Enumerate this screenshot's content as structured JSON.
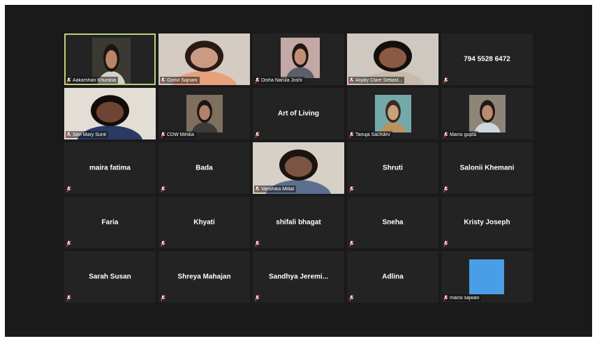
{
  "participants": [
    {
      "name": "Aakarshan Khurana",
      "display": "",
      "type": "video",
      "bg": "#3a3a33",
      "skin": "#b88666",
      "hair": "#1b1511",
      "shirt": "#d5d1c8"
    },
    {
      "name": "Gonvi Sajnani",
      "display": "",
      "type": "video",
      "bg": "#d4cbc3",
      "skin": "#c99b82",
      "hair": "#2b1a14",
      "shirt": "#e8a07c"
    },
    {
      "name": "Disha Narula Joshi",
      "display": "",
      "type": "video",
      "bg": "#c4a8a6",
      "skin": "#c18f74",
      "hair": "#221712",
      "shirt": "#5a5f6b"
    },
    {
      "name": "Anjaly Clare Sebast...",
      "display": "",
      "type": "video",
      "bg": "#cfc8c0",
      "skin": "#8b5a44",
      "hair": "#140f0d",
      "shirt": "#c9b9a9"
    },
    {
      "name": "",
      "display": "794 5528 6472",
      "type": "text"
    },
    {
      "name": "Silvi Mary Sunil",
      "display": "",
      "type": "video",
      "bg": "#e2ddd5",
      "skin": "#6e4535",
      "hair": "#120d0b",
      "shirt": "#2a3a63"
    },
    {
      "name": "CDW Mihika",
      "display": "",
      "type": "video",
      "bg": "#7e6f5f",
      "skin": "#b0826a",
      "hair": "#1e1612",
      "shirt": "#3d3a38"
    },
    {
      "name": "",
      "display": "Art of Living",
      "type": "text"
    },
    {
      "name": "Tanuja Sachdev",
      "display": "",
      "type": "video",
      "bg": "#74a9a9",
      "skin": "#c8a27e",
      "hair": "#3e2a1e",
      "shirt": "#b9925f"
    },
    {
      "name": "Mansi gupta",
      "display": "",
      "type": "video",
      "bg": "#8e8579",
      "skin": "#ba8b70",
      "hair": "#231813",
      "shirt": "#cfd6de"
    },
    {
      "name": "",
      "display": "maira fatima",
      "type": "text"
    },
    {
      "name": "",
      "display": "Bada",
      "type": "text"
    },
    {
      "name": "Vanshika Mittal",
      "display": "",
      "type": "video",
      "bg": "#d6d0c6",
      "skin": "#7b5444",
      "hair": "#1a1310",
      "shirt": "#5c6f8f"
    },
    {
      "name": "",
      "display": "Shruti",
      "type": "text"
    },
    {
      "name": "",
      "display": "Salonii Khemani",
      "type": "text"
    },
    {
      "name": "",
      "display": "Faria",
      "type": "text"
    },
    {
      "name": "",
      "display": "Khyati",
      "type": "text"
    },
    {
      "name": "",
      "display": "shifali bhagat",
      "type": "text"
    },
    {
      "name": "",
      "display": "Sneha",
      "type": "text"
    },
    {
      "name": "",
      "display": "Kristy Joseph",
      "type": "text"
    },
    {
      "name": "",
      "display": "Sarah Susan",
      "type": "text"
    },
    {
      "name": "",
      "display": "Shreya Mahajan",
      "type": "text"
    },
    {
      "name": "",
      "display": "Sandhya  Jeremi...",
      "type": "text"
    },
    {
      "name": "",
      "display": "Adlina",
      "type": "text"
    },
    {
      "name": "mansi sajwan",
      "display": "",
      "type": "avatar",
      "color": "#4a9ee6"
    }
  ],
  "colors": {
    "active_border": "#b9d27a",
    "mic_muted": "#e0403a",
    "tile_bg": "#232323"
  },
  "active_speaker": "Aakarshan Khurana"
}
